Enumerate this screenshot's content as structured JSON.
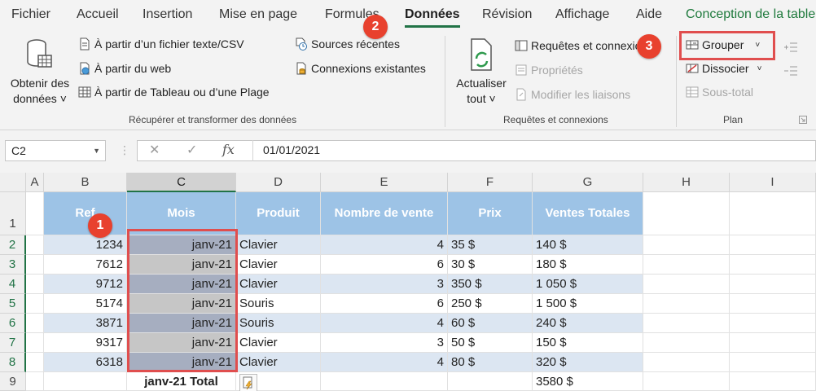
{
  "tabs": [
    "Fichier",
    "Accueil",
    "Insertion",
    "Mise en page",
    "Formules",
    "Données",
    "Révision",
    "Affichage",
    "Aide",
    "Conception de la table"
  ],
  "active_tab": "Données",
  "ribbon": {
    "get_data": {
      "line1": "Obtenir des",
      "line2": "données ˅"
    },
    "from_text_csv": "À partir d’un fichier texte/CSV",
    "from_web": "À partir du web",
    "from_table": "À partir de Tableau ou d’une Plage",
    "recent_sources": "Sources récentes",
    "existing_connections": "Connexions existantes",
    "group_get_transform": "Récupérer et transformer des données",
    "refresh_all": {
      "line1": "Actualiser",
      "line2": "tout ˅"
    },
    "queries_connections": "Requêtes et connexions",
    "properties": "Propriétés",
    "edit_links": "Modifier les liaisons",
    "group_queries": "Requêtes et connexions",
    "group_button": "Grouper",
    "ungroup_button": "Dissocier",
    "subtotal_button": "Sous-total",
    "group_plan": "Plan"
  },
  "badges": {
    "b1": "1",
    "b2": "2",
    "b3": "3"
  },
  "formula_bar": {
    "name_box": "C2",
    "cancel": "✕",
    "enter": "✓",
    "fx": "fx",
    "value": "01/01/2021"
  },
  "columns": [
    "A",
    "B",
    "C",
    "D",
    "E",
    "F",
    "G",
    "H",
    "I"
  ],
  "rows": [
    "1",
    "2",
    "3",
    "4",
    "5",
    "6",
    "7",
    "8",
    "9"
  ],
  "table": {
    "headers": [
      "Ref",
      "Mois",
      "Produit",
      "Nombre de vente",
      "Prix",
      "Ventes Totales"
    ],
    "data": [
      [
        "1234",
        "janv-21",
        "Clavier",
        "4",
        "35 $",
        "140 $"
      ],
      [
        "7612",
        "janv-21",
        "Clavier",
        "6",
        "30 $",
        "180 $"
      ],
      [
        "9712",
        "janv-21",
        "Clavier",
        "3",
        "350 $",
        "1 050 $"
      ],
      [
        "5174",
        "janv-21",
        "Souris",
        "6",
        "250 $",
        "1 500 $"
      ],
      [
        "3871",
        "janv-21",
        "Souris",
        "4",
        "60 $",
        "240 $"
      ],
      [
        "9317",
        "janv-21",
        "Clavier",
        "3",
        "50 $",
        "150 $"
      ],
      [
        "6318",
        "janv-21",
        "Clavier",
        "4",
        "80 $",
        "320 $"
      ]
    ],
    "total_label": "janv-21 Total",
    "total_value": "3580 $"
  },
  "colors": {
    "header_fill": "#9dc3e6",
    "band_fill": "#dce6f2",
    "accent": "#217346",
    "badge": "#e8412e"
  }
}
